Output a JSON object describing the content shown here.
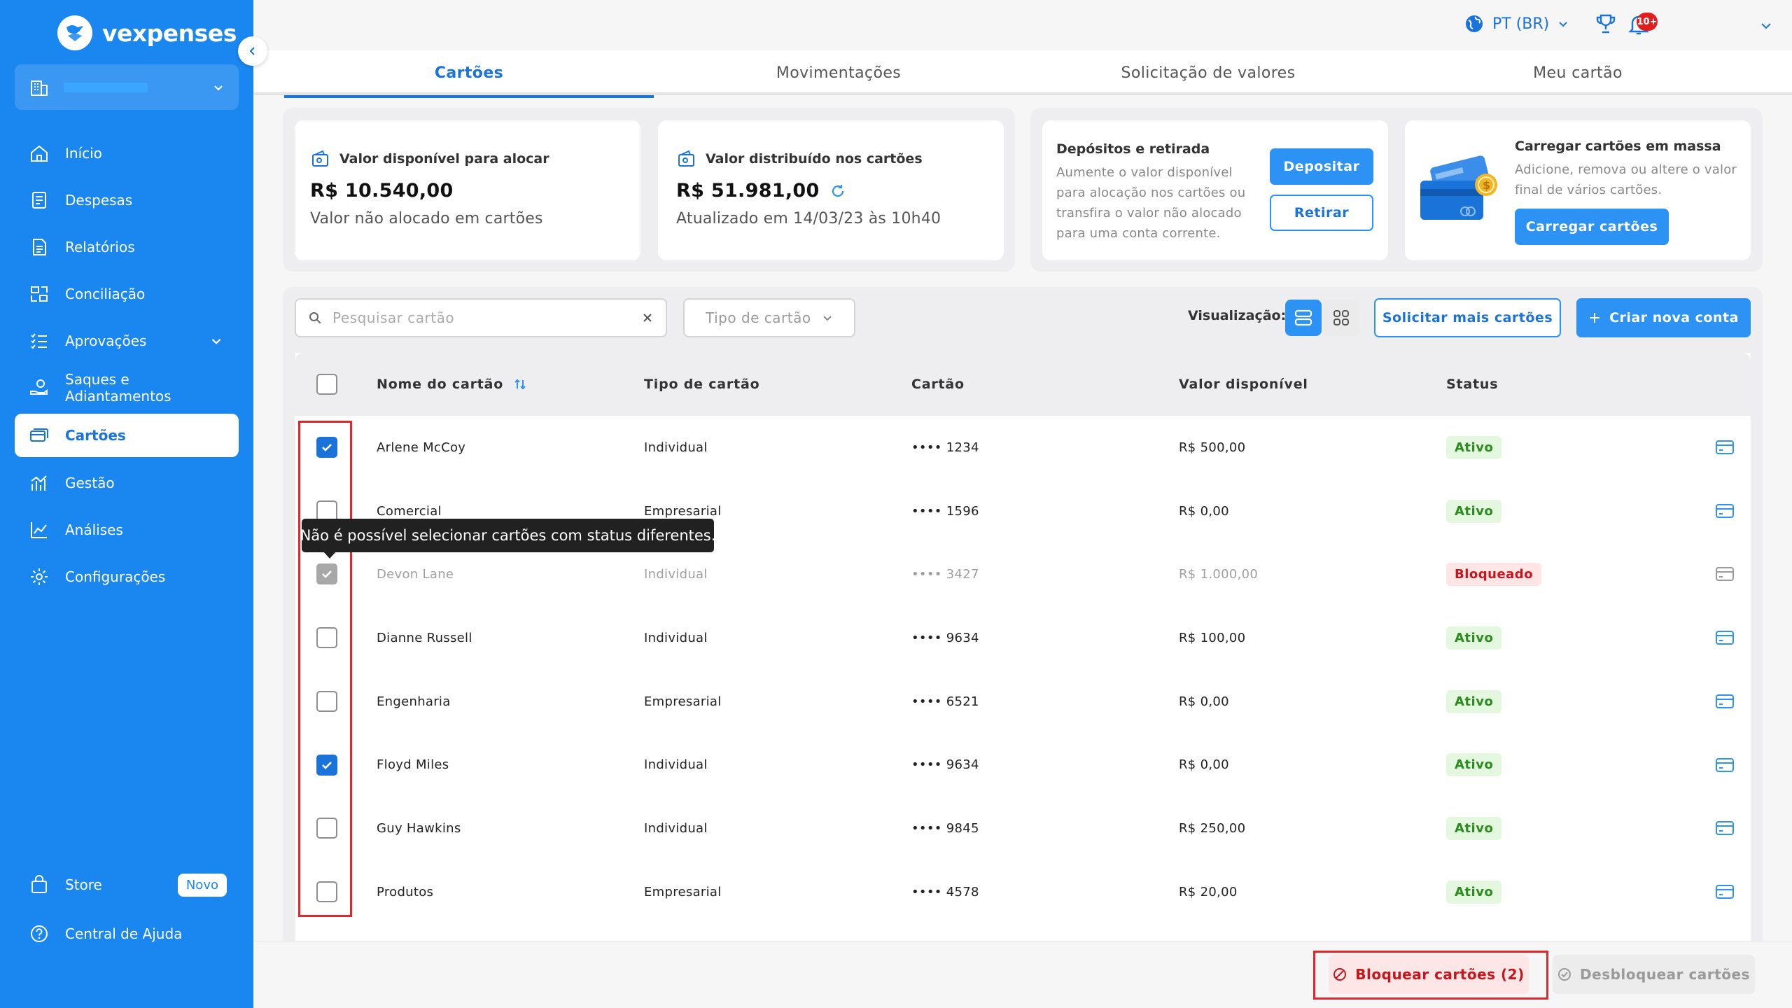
{
  "brand": {
    "name": "vexpenses"
  },
  "sidebar": {
    "items": [
      {
        "label": "Início",
        "icon": "home-icon"
      },
      {
        "label": "Despesas",
        "icon": "receipt-icon"
      },
      {
        "label": "Relatórios",
        "icon": "document-icon"
      },
      {
        "label": "Conciliação",
        "icon": "reconcile-icon"
      },
      {
        "label": "Aprovações",
        "icon": "checklist-icon"
      },
      {
        "label": "Saques e Adiantamentos",
        "icon": "money-hand-icon"
      },
      {
        "label": "Cartões",
        "icon": "cards-icon",
        "active": true
      },
      {
        "label": "Gestão",
        "icon": "management-chart-icon"
      },
      {
        "label": "Análises",
        "icon": "line-chart-icon"
      },
      {
        "label": "Configurações",
        "icon": "gear-icon"
      }
    ],
    "store": {
      "label": "Store",
      "badge": "Novo"
    },
    "help": {
      "label": "Central de Ajuda"
    }
  },
  "header": {
    "language": "PT (BR)",
    "notifications": "10+"
  },
  "tabs": [
    {
      "label": "Cartões",
      "active": true
    },
    {
      "label": "Movimentações"
    },
    {
      "label": "Solicitação de valores"
    },
    {
      "label": "Meu cartão"
    }
  ],
  "summary": {
    "available": {
      "label": "Valor disponível para alocar",
      "value": "R$ 10.540,00",
      "sub": "Valor não alocado em cartões"
    },
    "distributed": {
      "label": "Valor distribuído nos cartões",
      "value": "R$ 51.981,00",
      "sub": "Atualizado em 14/03/23 às 10h40"
    },
    "deposits": {
      "title": "Depósitos e retirada",
      "desc": [
        "Aumente o valor disponível",
        "para alocação nos cartões ou",
        "transfira o valor não alocado",
        "para uma conta corrente."
      ],
      "deposit_label": "Depositar",
      "withdraw_label": "Retirar"
    },
    "bulk": {
      "title": "Carregar cartões em massa",
      "desc": [
        "Adicione, remova ou altere o valor",
        "final de vários cartões."
      ],
      "button": "Carregar cartões"
    }
  },
  "toolbar": {
    "search_placeholder": "Pesquisar cartão",
    "type_placeholder": "Tipo de cartão",
    "view_label": "Visualização:",
    "request_more": "Solicitar mais cartões",
    "create_account": "Criar nova conta"
  },
  "table": {
    "headers": [
      "Nome do cartão",
      "Tipo de cartão",
      "Cartão",
      "Valor disponível",
      "Status"
    ],
    "rows": [
      {
        "name": "Arlene McCoy",
        "type": "Individual",
        "card": "•••• 1234",
        "value": "R$ 500,00",
        "status": "Ativo",
        "checked": true
      },
      {
        "name": "Comercial",
        "type": "Empresarial",
        "card": "•••• 1596",
        "value": "R$ 0,00",
        "status": "Ativo",
        "checked": false
      },
      {
        "name": "Devon Lane",
        "type": "Individual",
        "card": "•••• 3427",
        "value": "R$ 1.000,00",
        "status": "Bloqueado",
        "checked": true,
        "disabled": true
      },
      {
        "name": "Dianne Russell",
        "type": "Individual",
        "card": "•••• 9634",
        "value": "R$ 100,00",
        "status": "Ativo",
        "checked": false
      },
      {
        "name": "Engenharia",
        "type": "Empresarial",
        "card": "•••• 6521",
        "value": "R$ 0,00",
        "status": "Ativo",
        "checked": false
      },
      {
        "name": "Floyd Miles",
        "type": "Individual",
        "card": "•••• 9634",
        "value": "R$ 0,00",
        "status": "Ativo",
        "checked": true
      },
      {
        "name": "Guy Hawkins",
        "type": "Individual",
        "card": "•••• 9845",
        "value": "R$ 250,00",
        "status": "Ativo",
        "checked": false
      },
      {
        "name": "Produtos",
        "type": "Empresarial",
        "card": "•••• 4578",
        "value": "R$ 20,00",
        "status": "Ativo",
        "checked": false
      }
    ]
  },
  "tooltip": "Não é possível selecionar cartões com status diferentes.",
  "footer": {
    "block_label": "Bloquear cartões (2)",
    "unblock_label": "Desbloquear cartões"
  },
  "colors": {
    "primary": "#1a87f0",
    "accent": "#1a73d9",
    "danger": "#c4161c",
    "success": "#2c8b1e"
  }
}
